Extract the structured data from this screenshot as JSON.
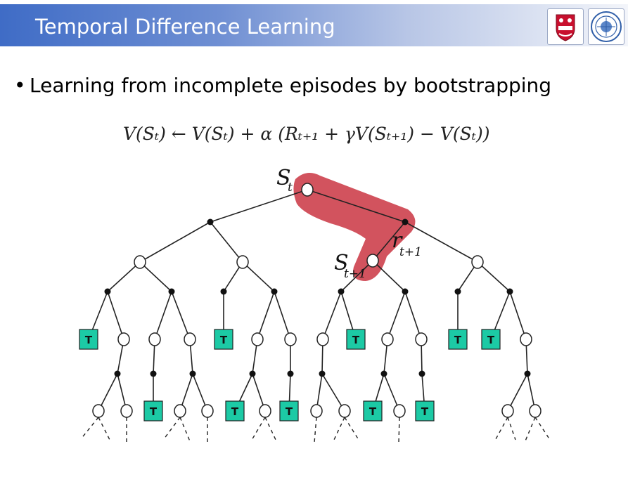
{
  "header": {
    "title": "Temporal Difference Learning"
  },
  "bullet": {
    "text": "Learning from incomplete episodes by bootstrapping"
  },
  "formula": {
    "text": "V(Sₜ) ← V(Sₜ) + α (Rₜ₊₁ + γV(Sₜ₊₁) − V(Sₜ))"
  },
  "diagram": {
    "state_label_t": "S",
    "state_label_t_sub": "t",
    "reward_label": "r",
    "reward_label_sub": "t+1",
    "state_label_t1": "S",
    "state_label_t1_sub": "t+1",
    "terminal_label": "T",
    "colors": {
      "highlight": "#d04a55",
      "terminal": "#1ccaa5",
      "line": "#222222"
    }
  }
}
